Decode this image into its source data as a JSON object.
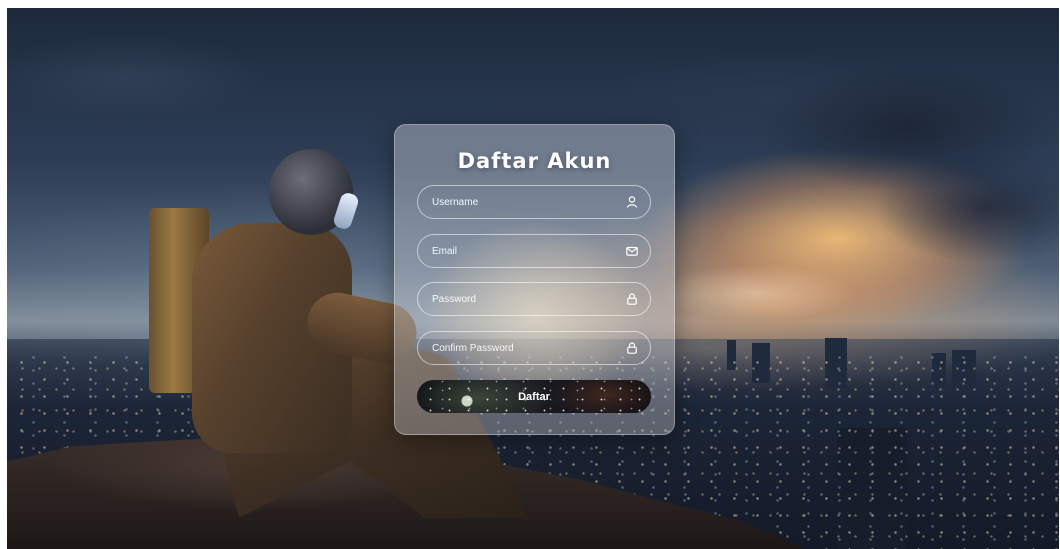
{
  "form": {
    "title": "Daftar Akun",
    "fields": [
      {
        "placeholder": "Username",
        "value": "",
        "icon": "user-icon"
      },
      {
        "placeholder": "Email",
        "value": "",
        "icon": "mail-icon"
      },
      {
        "placeholder": "Password",
        "value": "",
        "icon": "lock-icon"
      },
      {
        "placeholder": "Confirm Password",
        "value": "",
        "icon": "lock-icon"
      }
    ],
    "submit_label": "Daftar"
  },
  "colors": {
    "text": "#ffffff",
    "field_border": "#ffffff",
    "button_bg": "#101116"
  }
}
